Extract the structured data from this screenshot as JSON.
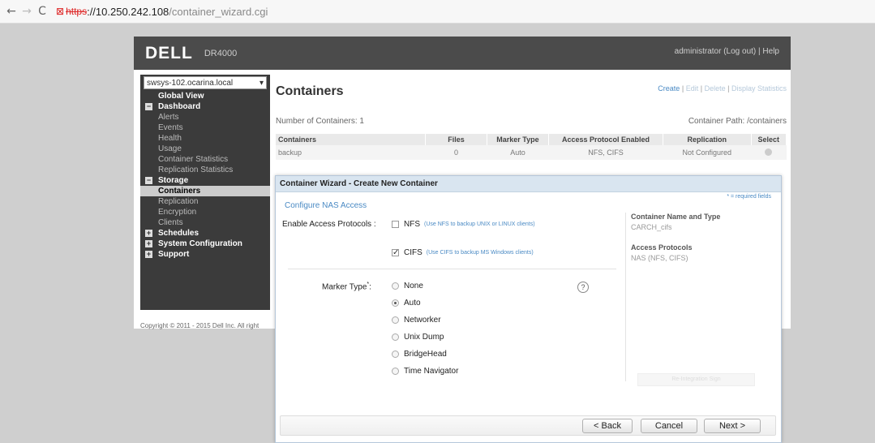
{
  "browser": {
    "back": "←",
    "forward": "→",
    "reload": "C",
    "lock": "⊠",
    "scheme": "https",
    "host": "://10.250.242.108",
    "path": "/container_wizard.cgi"
  },
  "app": {
    "logo": "DELL",
    "product": "DR4000",
    "user": "administrator (Log out)",
    "separator": "|",
    "help": "Help",
    "copyright": "Copyright © 2011 - 2015 Dell Inc. All right"
  },
  "sidebar": {
    "system": "swsys-102.ocarina.local",
    "items": [
      {
        "label": "Global View",
        "type": "cat",
        "toggle": ""
      },
      {
        "label": "Dashboard",
        "type": "cat",
        "toggle": "−"
      },
      {
        "label": "Alerts",
        "type": "sub"
      },
      {
        "label": "Events",
        "type": "sub"
      },
      {
        "label": "Health",
        "type": "sub"
      },
      {
        "label": "Usage",
        "type": "sub"
      },
      {
        "label": "Container Statistics",
        "type": "sub"
      },
      {
        "label": "Replication Statistics",
        "type": "sub"
      },
      {
        "label": "Storage",
        "type": "cat",
        "toggle": "−"
      },
      {
        "label": "Containers",
        "type": "sub",
        "selected": true
      },
      {
        "label": "Replication",
        "type": "sub"
      },
      {
        "label": "Encryption",
        "type": "sub"
      },
      {
        "label": "Clients",
        "type": "sub"
      },
      {
        "label": "Schedules",
        "type": "cat",
        "toggle": "+"
      },
      {
        "label": "System Configuration",
        "type": "cat",
        "toggle": "+"
      },
      {
        "label": "Support",
        "type": "cat",
        "toggle": "+"
      }
    ]
  },
  "main": {
    "title": "Containers",
    "actions": {
      "create": "Create",
      "sep": "|",
      "edit": "Edit",
      "delete": "Delete",
      "display_stats": "Display Statistics"
    },
    "count_label": "Number of Containers: 1",
    "path_label": "Container Path: /containers",
    "table": {
      "headers": [
        "Containers",
        "Files",
        "Marker Type",
        "Access Protocol Enabled",
        "Replication",
        "Select"
      ],
      "rows": [
        [
          "backup",
          "0",
          "Auto",
          "NFS, CIFS",
          "Not Configured"
        ]
      ]
    }
  },
  "wizard": {
    "title": "Container Wizard - Create New Container",
    "required_note": "* = required fields",
    "section": "Configure NAS Access",
    "protocols_label": "Enable Access Protocols :",
    "nfs": {
      "label": "NFS",
      "hint": "(Use NFS to backup UNIX or LINUX clients)",
      "checked": false
    },
    "cifs": {
      "label": "CIFS",
      "hint": "(Use CIFS to backup MS Windows clients)",
      "checked": true
    },
    "marker_label": "Marker Type",
    "marker_req": "*",
    "marker_colon": ":",
    "marker_options": [
      "None",
      "Auto",
      "Networker",
      "Unix Dump",
      "BridgeHead",
      "Time Navigator"
    ],
    "marker_selected": "Auto",
    "help": "?",
    "summary": {
      "name_header": "Container Name and Type",
      "name_value": "CARCH_cifs",
      "protocols_header": "Access Protocols",
      "protocols_value": "NAS (NFS, CIFS)",
      "ghost_button": "Re-Integration Sign"
    },
    "buttons": {
      "back": "< Back",
      "cancel": "Cancel",
      "next": "Next >"
    }
  }
}
